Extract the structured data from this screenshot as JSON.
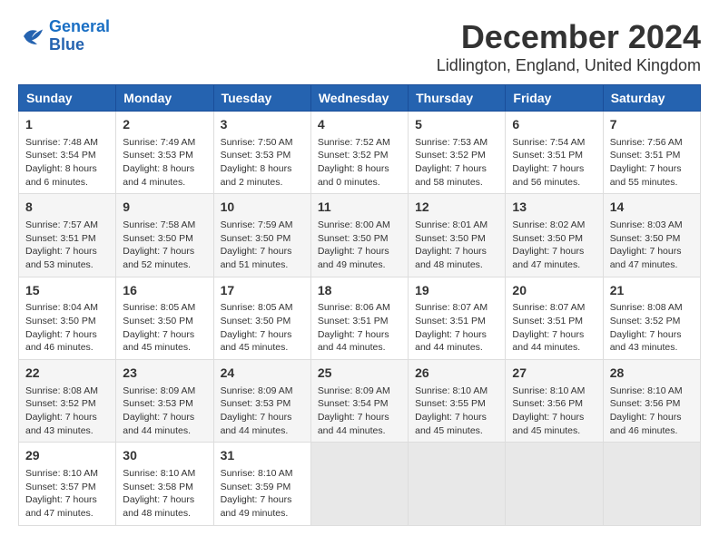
{
  "logo": {
    "line1": "General",
    "line2": "Blue"
  },
  "title": "December 2024",
  "subtitle": "Lidlington, England, United Kingdom",
  "headers": [
    "Sunday",
    "Monday",
    "Tuesday",
    "Wednesday",
    "Thursday",
    "Friday",
    "Saturday"
  ],
  "weeks": [
    [
      {
        "day": "1",
        "sunrise": "7:48 AM",
        "sunset": "3:54 PM",
        "daylight": "8 hours and 6 minutes."
      },
      {
        "day": "2",
        "sunrise": "7:49 AM",
        "sunset": "3:53 PM",
        "daylight": "8 hours and 4 minutes."
      },
      {
        "day": "3",
        "sunrise": "7:50 AM",
        "sunset": "3:53 PM",
        "daylight": "8 hours and 2 minutes."
      },
      {
        "day": "4",
        "sunrise": "7:52 AM",
        "sunset": "3:52 PM",
        "daylight": "8 hours and 0 minutes."
      },
      {
        "day": "5",
        "sunrise": "7:53 AM",
        "sunset": "3:52 PM",
        "daylight": "7 hours and 58 minutes."
      },
      {
        "day": "6",
        "sunrise": "7:54 AM",
        "sunset": "3:51 PM",
        "daylight": "7 hours and 56 minutes."
      },
      {
        "day": "7",
        "sunrise": "7:56 AM",
        "sunset": "3:51 PM",
        "daylight": "7 hours and 55 minutes."
      }
    ],
    [
      {
        "day": "8",
        "sunrise": "7:57 AM",
        "sunset": "3:51 PM",
        "daylight": "7 hours and 53 minutes."
      },
      {
        "day": "9",
        "sunrise": "7:58 AM",
        "sunset": "3:50 PM",
        "daylight": "7 hours and 52 minutes."
      },
      {
        "day": "10",
        "sunrise": "7:59 AM",
        "sunset": "3:50 PM",
        "daylight": "7 hours and 51 minutes."
      },
      {
        "day": "11",
        "sunrise": "8:00 AM",
        "sunset": "3:50 PM",
        "daylight": "7 hours and 49 minutes."
      },
      {
        "day": "12",
        "sunrise": "8:01 AM",
        "sunset": "3:50 PM",
        "daylight": "7 hours and 48 minutes."
      },
      {
        "day": "13",
        "sunrise": "8:02 AM",
        "sunset": "3:50 PM",
        "daylight": "7 hours and 47 minutes."
      },
      {
        "day": "14",
        "sunrise": "8:03 AM",
        "sunset": "3:50 PM",
        "daylight": "7 hours and 47 minutes."
      }
    ],
    [
      {
        "day": "15",
        "sunrise": "8:04 AM",
        "sunset": "3:50 PM",
        "daylight": "7 hours and 46 minutes."
      },
      {
        "day": "16",
        "sunrise": "8:05 AM",
        "sunset": "3:50 PM",
        "daylight": "7 hours and 45 minutes."
      },
      {
        "day": "17",
        "sunrise": "8:05 AM",
        "sunset": "3:50 PM",
        "daylight": "7 hours and 45 minutes."
      },
      {
        "day": "18",
        "sunrise": "8:06 AM",
        "sunset": "3:51 PM",
        "daylight": "7 hours and 44 minutes."
      },
      {
        "day": "19",
        "sunrise": "8:07 AM",
        "sunset": "3:51 PM",
        "daylight": "7 hours and 44 minutes."
      },
      {
        "day": "20",
        "sunrise": "8:07 AM",
        "sunset": "3:51 PM",
        "daylight": "7 hours and 44 minutes."
      },
      {
        "day": "21",
        "sunrise": "8:08 AM",
        "sunset": "3:52 PM",
        "daylight": "7 hours and 43 minutes."
      }
    ],
    [
      {
        "day": "22",
        "sunrise": "8:08 AM",
        "sunset": "3:52 PM",
        "daylight": "7 hours and 43 minutes."
      },
      {
        "day": "23",
        "sunrise": "8:09 AM",
        "sunset": "3:53 PM",
        "daylight": "7 hours and 44 minutes."
      },
      {
        "day": "24",
        "sunrise": "8:09 AM",
        "sunset": "3:53 PM",
        "daylight": "7 hours and 44 minutes."
      },
      {
        "day": "25",
        "sunrise": "8:09 AM",
        "sunset": "3:54 PM",
        "daylight": "7 hours and 44 minutes."
      },
      {
        "day": "26",
        "sunrise": "8:10 AM",
        "sunset": "3:55 PM",
        "daylight": "7 hours and 45 minutes."
      },
      {
        "day": "27",
        "sunrise": "8:10 AM",
        "sunset": "3:56 PM",
        "daylight": "7 hours and 45 minutes."
      },
      {
        "day": "28",
        "sunrise": "8:10 AM",
        "sunset": "3:56 PM",
        "daylight": "7 hours and 46 minutes."
      }
    ],
    [
      {
        "day": "29",
        "sunrise": "8:10 AM",
        "sunset": "3:57 PM",
        "daylight": "7 hours and 47 minutes."
      },
      {
        "day": "30",
        "sunrise": "8:10 AM",
        "sunset": "3:58 PM",
        "daylight": "7 hours and 48 minutes."
      },
      {
        "day": "31",
        "sunrise": "8:10 AM",
        "sunset": "3:59 PM",
        "daylight": "7 hours and 49 minutes."
      },
      null,
      null,
      null,
      null
    ]
  ]
}
